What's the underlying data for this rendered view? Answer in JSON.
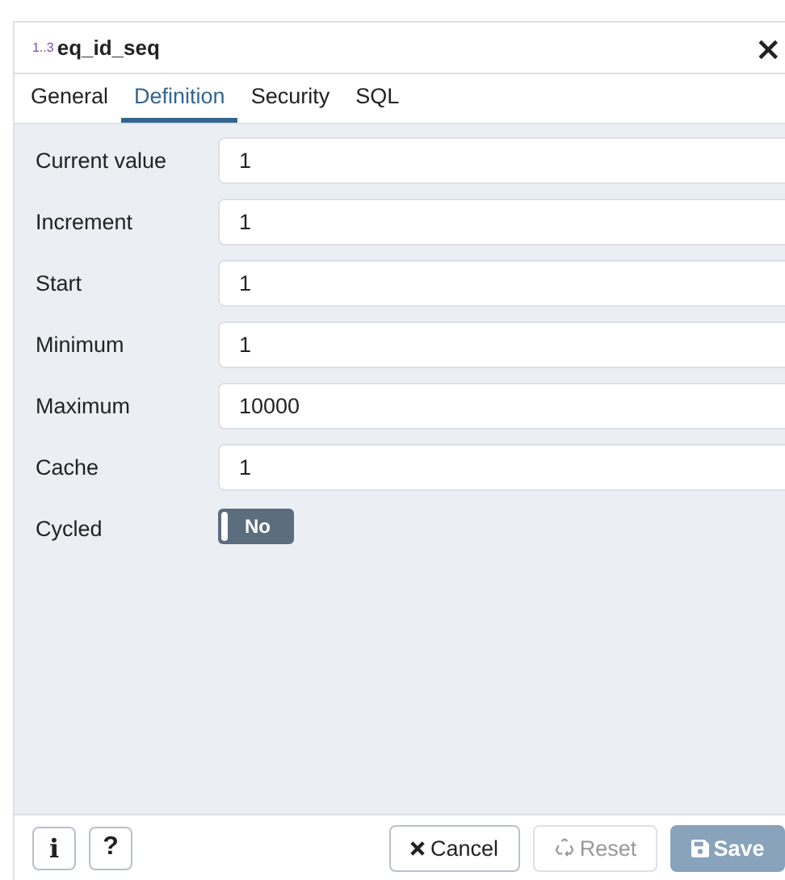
{
  "dialog": {
    "icon_text": "1..3",
    "title": "eq_id_seq",
    "close": "×"
  },
  "tabs": [
    {
      "label": "General",
      "selected": false
    },
    {
      "label": "Definition",
      "selected": true
    },
    {
      "label": "Security",
      "selected": false
    },
    {
      "label": "SQL",
      "selected": false
    }
  ],
  "fields": [
    {
      "kind": "text",
      "label": "Current value",
      "value": "1"
    },
    {
      "kind": "text",
      "label": "Increment",
      "value": "1"
    },
    {
      "kind": "text",
      "label": "Start",
      "value": "1"
    },
    {
      "kind": "text",
      "label": "Minimum",
      "value": "1"
    },
    {
      "kind": "text",
      "label": "Maximum",
      "value": "10000"
    },
    {
      "kind": "text",
      "label": "Cache",
      "value": "1"
    },
    {
      "kind": "switch",
      "label": "Cycled",
      "on": false,
      "value": "No"
    }
  ],
  "footer": {
    "left_buttons": [
      {
        "kind": "info",
        "label": "i"
      },
      {
        "kind": "help",
        "label": "?"
      }
    ],
    "right_buttons": [
      {
        "kind": "cancel",
        "label": "Cancel",
        "disabled": false
      },
      {
        "kind": "reset",
        "label": "Reset",
        "disabled": true
      },
      {
        "kind": "save",
        "label": "Save",
        "disabled": true
      }
    ]
  }
}
